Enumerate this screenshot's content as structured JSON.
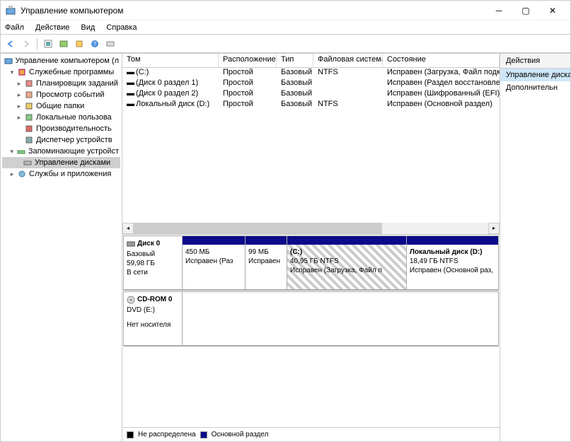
{
  "window": {
    "title": "Управление компьютером"
  },
  "menu": {
    "file": "Файл",
    "action": "Действие",
    "view": "Вид",
    "help": "Справка"
  },
  "tree": {
    "root": "Управление компьютером (л",
    "systools": "Служебные программы",
    "systools_items": [
      "Планировщик заданий",
      "Просмотр событий",
      "Общие папки",
      "Локальные пользова",
      "Производительность",
      "Диспетчер устройств"
    ],
    "storage": "Запоминающие устройст",
    "diskmgmt": "Управление дисками",
    "services": "Службы и приложения"
  },
  "table": {
    "headers": [
      "Том",
      "Расположение",
      "Тип",
      "Файловая система",
      "Состояние"
    ],
    "rows": [
      {
        "name": "(C:)",
        "loc": "Простой",
        "type": "Базовый",
        "fs": "NTFS",
        "state": "Исправен (Загрузка, Файл подкач"
      },
      {
        "name": "(Диск 0 раздел 1)",
        "loc": "Простой",
        "type": "Базовый",
        "fs": "",
        "state": "Исправен (Раздел восстановлены"
      },
      {
        "name": "(Диск 0 раздел 2)",
        "loc": "Простой",
        "type": "Базовый",
        "fs": "",
        "state": "Исправен (Шифрованный (EFI) си"
      },
      {
        "name": "Локальный диск (D:)",
        "loc": "Простой",
        "type": "Базовый",
        "fs": "NTFS",
        "state": "Исправен (Основной раздел)"
      }
    ]
  },
  "disks": {
    "disk0": {
      "title": "Диск 0",
      "type": "Базовый",
      "size": "59,98 ГБ",
      "status": "В сети"
    },
    "cdrom": {
      "title": "CD-ROM 0",
      "sub": "DVD (E:)",
      "empty": "Нет носителя"
    },
    "parts": [
      {
        "top": "",
        "l1": "450 МБ",
        "l2": "Исправен (Раз"
      },
      {
        "top": "",
        "l1": "99 МБ",
        "l2": "Исправен"
      },
      {
        "top": "(C:)",
        "l1": "40,95 ГБ NTFS",
        "l2": "Исправен (Загрузка, Файл п"
      },
      {
        "top": "Локальный диск (D:)",
        "l1": "18,49 ГБ NTFS",
        "l2": "Исправен (Основной раз,"
      }
    ]
  },
  "legend": {
    "unalloc": "Не распределена",
    "primary": "Основной раздел"
  },
  "actions": {
    "heading": "Действия",
    "hl": "Управление диска",
    "more": "Дополнительн"
  }
}
